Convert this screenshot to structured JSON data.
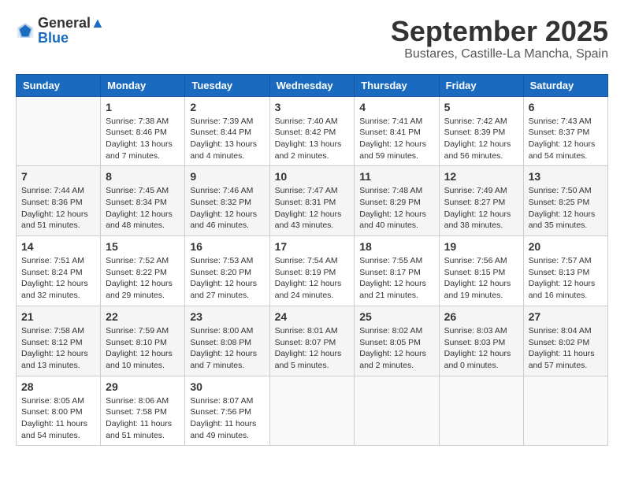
{
  "header": {
    "logo_general": "General",
    "logo_blue": "Blue",
    "month_title": "September 2025",
    "location": "Bustares, Castille-La Mancha, Spain"
  },
  "days_of_week": [
    "Sunday",
    "Monday",
    "Tuesday",
    "Wednesday",
    "Thursday",
    "Friday",
    "Saturday"
  ],
  "weeks": [
    [
      {
        "day": "",
        "info": ""
      },
      {
        "day": "1",
        "info": "Sunrise: 7:38 AM\nSunset: 8:46 PM\nDaylight: 13 hours\nand 7 minutes."
      },
      {
        "day": "2",
        "info": "Sunrise: 7:39 AM\nSunset: 8:44 PM\nDaylight: 13 hours\nand 4 minutes."
      },
      {
        "day": "3",
        "info": "Sunrise: 7:40 AM\nSunset: 8:42 PM\nDaylight: 13 hours\nand 2 minutes."
      },
      {
        "day": "4",
        "info": "Sunrise: 7:41 AM\nSunset: 8:41 PM\nDaylight: 12 hours\nand 59 minutes."
      },
      {
        "day": "5",
        "info": "Sunrise: 7:42 AM\nSunset: 8:39 PM\nDaylight: 12 hours\nand 56 minutes."
      },
      {
        "day": "6",
        "info": "Sunrise: 7:43 AM\nSunset: 8:37 PM\nDaylight: 12 hours\nand 54 minutes."
      }
    ],
    [
      {
        "day": "7",
        "info": "Sunrise: 7:44 AM\nSunset: 8:36 PM\nDaylight: 12 hours\nand 51 minutes."
      },
      {
        "day": "8",
        "info": "Sunrise: 7:45 AM\nSunset: 8:34 PM\nDaylight: 12 hours\nand 48 minutes."
      },
      {
        "day": "9",
        "info": "Sunrise: 7:46 AM\nSunset: 8:32 PM\nDaylight: 12 hours\nand 46 minutes."
      },
      {
        "day": "10",
        "info": "Sunrise: 7:47 AM\nSunset: 8:31 PM\nDaylight: 12 hours\nand 43 minutes."
      },
      {
        "day": "11",
        "info": "Sunrise: 7:48 AM\nSunset: 8:29 PM\nDaylight: 12 hours\nand 40 minutes."
      },
      {
        "day": "12",
        "info": "Sunrise: 7:49 AM\nSunset: 8:27 PM\nDaylight: 12 hours\nand 38 minutes."
      },
      {
        "day": "13",
        "info": "Sunrise: 7:50 AM\nSunset: 8:25 PM\nDaylight: 12 hours\nand 35 minutes."
      }
    ],
    [
      {
        "day": "14",
        "info": "Sunrise: 7:51 AM\nSunset: 8:24 PM\nDaylight: 12 hours\nand 32 minutes."
      },
      {
        "day": "15",
        "info": "Sunrise: 7:52 AM\nSunset: 8:22 PM\nDaylight: 12 hours\nand 29 minutes."
      },
      {
        "day": "16",
        "info": "Sunrise: 7:53 AM\nSunset: 8:20 PM\nDaylight: 12 hours\nand 27 minutes."
      },
      {
        "day": "17",
        "info": "Sunrise: 7:54 AM\nSunset: 8:19 PM\nDaylight: 12 hours\nand 24 minutes."
      },
      {
        "day": "18",
        "info": "Sunrise: 7:55 AM\nSunset: 8:17 PM\nDaylight: 12 hours\nand 21 minutes."
      },
      {
        "day": "19",
        "info": "Sunrise: 7:56 AM\nSunset: 8:15 PM\nDaylight: 12 hours\nand 19 minutes."
      },
      {
        "day": "20",
        "info": "Sunrise: 7:57 AM\nSunset: 8:13 PM\nDaylight: 12 hours\nand 16 minutes."
      }
    ],
    [
      {
        "day": "21",
        "info": "Sunrise: 7:58 AM\nSunset: 8:12 PM\nDaylight: 12 hours\nand 13 minutes."
      },
      {
        "day": "22",
        "info": "Sunrise: 7:59 AM\nSunset: 8:10 PM\nDaylight: 12 hours\nand 10 minutes."
      },
      {
        "day": "23",
        "info": "Sunrise: 8:00 AM\nSunset: 8:08 PM\nDaylight: 12 hours\nand 7 minutes."
      },
      {
        "day": "24",
        "info": "Sunrise: 8:01 AM\nSunset: 8:07 PM\nDaylight: 12 hours\nand 5 minutes."
      },
      {
        "day": "25",
        "info": "Sunrise: 8:02 AM\nSunset: 8:05 PM\nDaylight: 12 hours\nand 2 minutes."
      },
      {
        "day": "26",
        "info": "Sunrise: 8:03 AM\nSunset: 8:03 PM\nDaylight: 12 hours\nand 0 minutes."
      },
      {
        "day": "27",
        "info": "Sunrise: 8:04 AM\nSunset: 8:02 PM\nDaylight: 11 hours\nand 57 minutes."
      }
    ],
    [
      {
        "day": "28",
        "info": "Sunrise: 8:05 AM\nSunset: 8:00 PM\nDaylight: 11 hours\nand 54 minutes."
      },
      {
        "day": "29",
        "info": "Sunrise: 8:06 AM\nSunset: 7:58 PM\nDaylight: 11 hours\nand 51 minutes."
      },
      {
        "day": "30",
        "info": "Sunrise: 8:07 AM\nSunset: 7:56 PM\nDaylight: 11 hours\nand 49 minutes."
      },
      {
        "day": "",
        "info": ""
      },
      {
        "day": "",
        "info": ""
      },
      {
        "day": "",
        "info": ""
      },
      {
        "day": "",
        "info": ""
      }
    ]
  ]
}
